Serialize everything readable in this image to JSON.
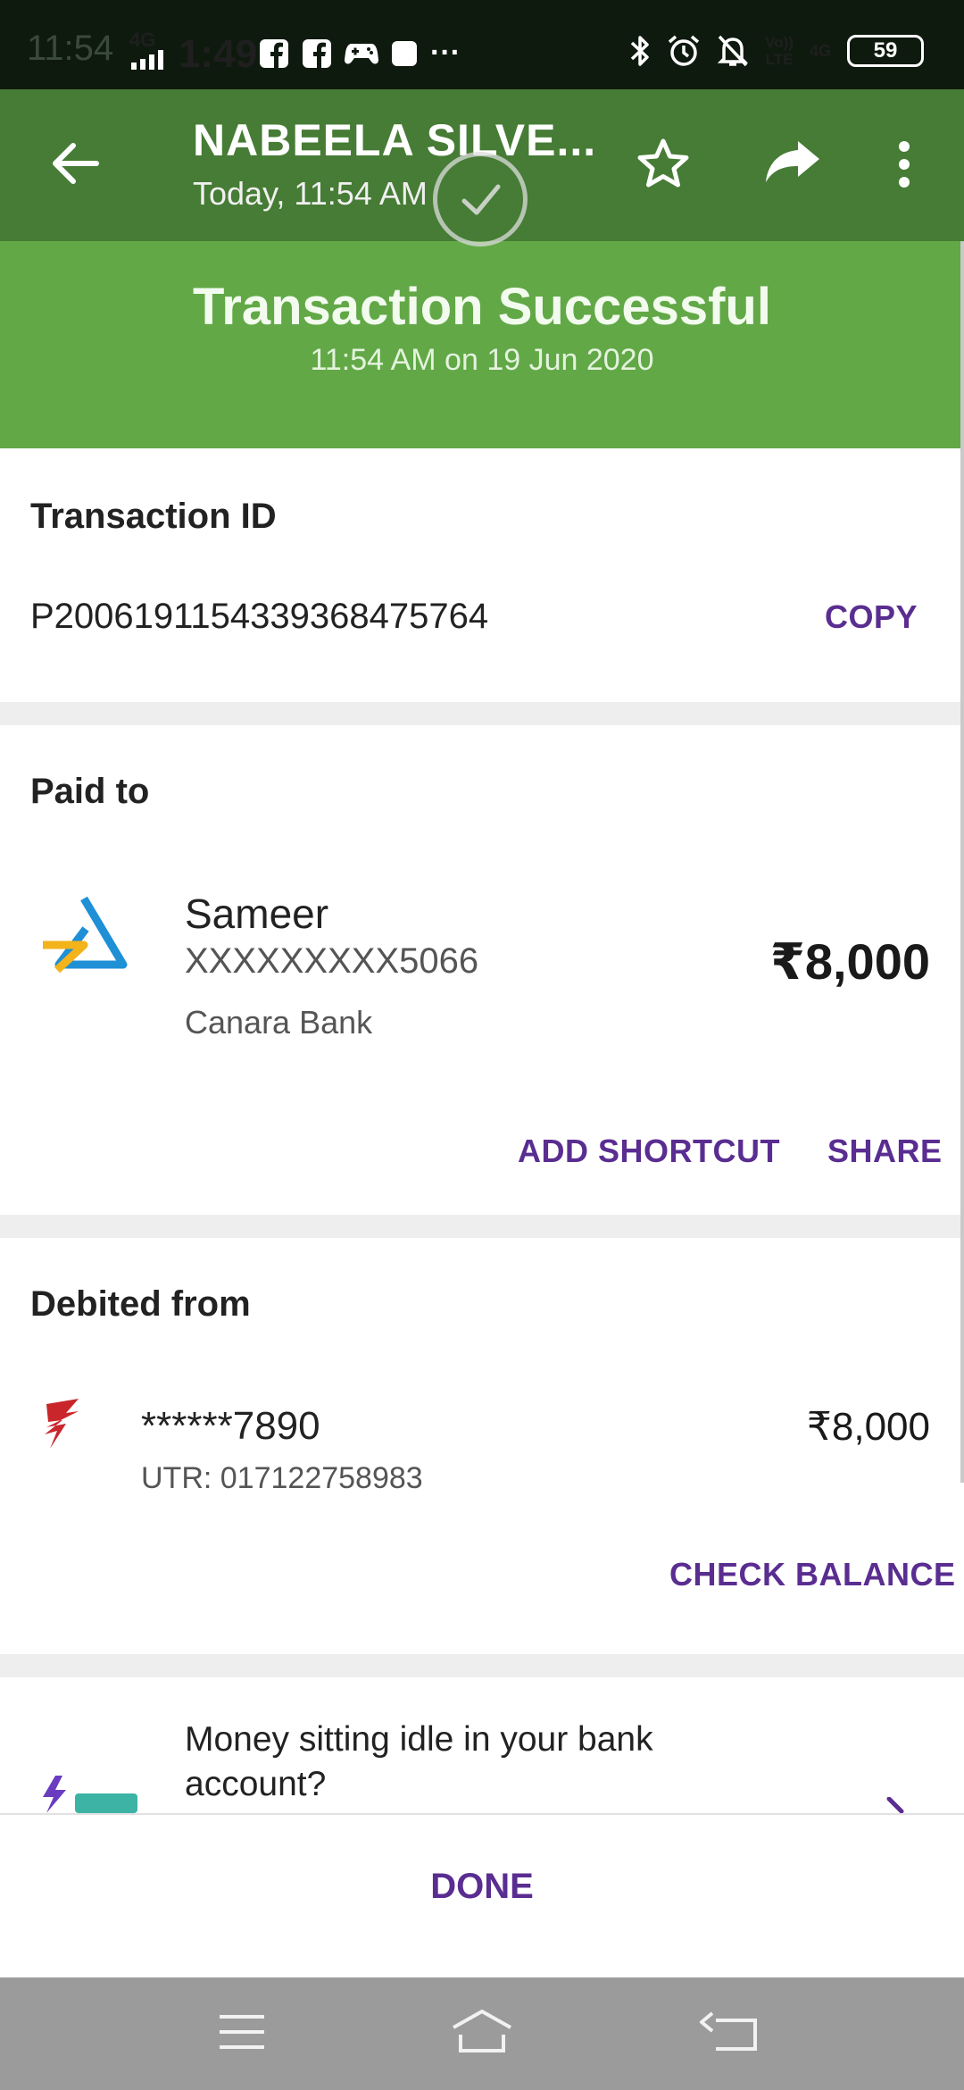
{
  "status_bar": {
    "ghost_time": "11:54",
    "network": "4G",
    "time": "1:49",
    "more": "···",
    "volte_line1": "Vo))",
    "volte_line2": "LTE",
    "net2": "4G",
    "battery": "59"
  },
  "header": {
    "title": "NABEELA SILVE...",
    "subtitle": "Today, 11:54 AM"
  },
  "banner": {
    "title": "Transaction Successful",
    "subtitle": "11:54 AM on 19 Jun 2020"
  },
  "transaction": {
    "label": "Transaction ID",
    "id": "P2006191154339368475764",
    "copy_label": "COPY"
  },
  "paid_to": {
    "label": "Paid to",
    "name": "Sameer",
    "account": "XXXXXXXXX5066",
    "bank": "Canara Bank",
    "amount": "₹8,000",
    "add_shortcut_label": "ADD SHORTCUT",
    "share_label": "SHARE"
  },
  "debited_from": {
    "label": "Debited from",
    "account": "******7890",
    "utr": "UTR: 017122758983",
    "amount": "₹8,000",
    "check_balance_label": "CHECK BALANCE"
  },
  "promo": {
    "line1": "Money sitting idle in your bank",
    "line2": "account?"
  },
  "footer": {
    "done_label": "DONE"
  },
  "colors": {
    "appbar": "#467c35",
    "banner": "#62a847",
    "accent": "#5a2d91",
    "statusbar": "#0f1a0f",
    "navbar": "#9b9b9b"
  }
}
